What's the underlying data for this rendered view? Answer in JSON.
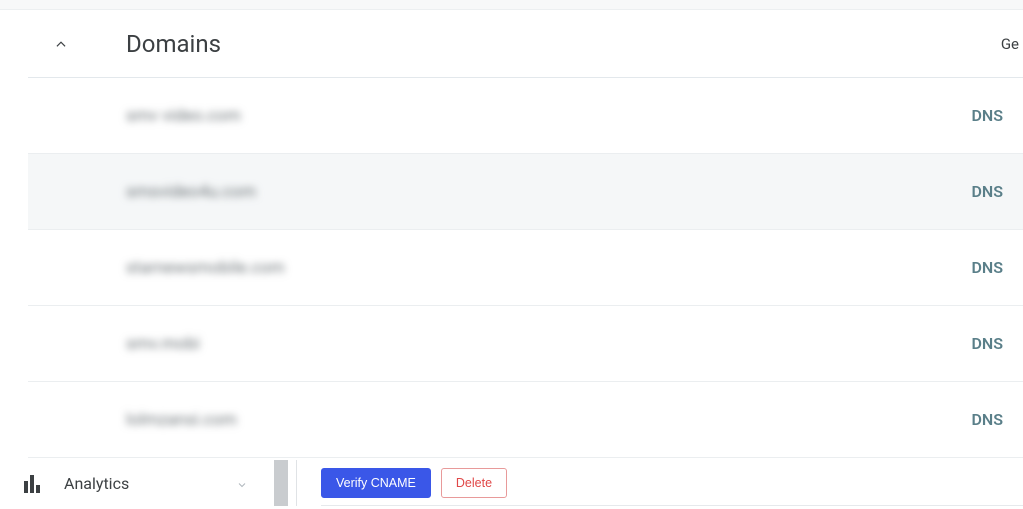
{
  "section": {
    "title": "Domains",
    "header_right": "Ge"
  },
  "rows": [
    {
      "domain": "smv video.com",
      "badge": "DNS",
      "highlighted": false
    },
    {
      "domain": "smsvideo4u.com",
      "badge": "DNS",
      "highlighted": true
    },
    {
      "domain": "starnewsmobile.com",
      "badge": "DNS",
      "highlighted": false
    },
    {
      "domain": "smv.mobi",
      "badge": "DNS",
      "highlighted": false
    },
    {
      "domain": "lolmzansi.com",
      "badge": "DNS",
      "highlighted": false
    }
  ],
  "sidebar": {
    "analytics_label": "Analytics"
  },
  "actions": {
    "verify_cname": "Verify CNAME",
    "delete": "Delete"
  }
}
